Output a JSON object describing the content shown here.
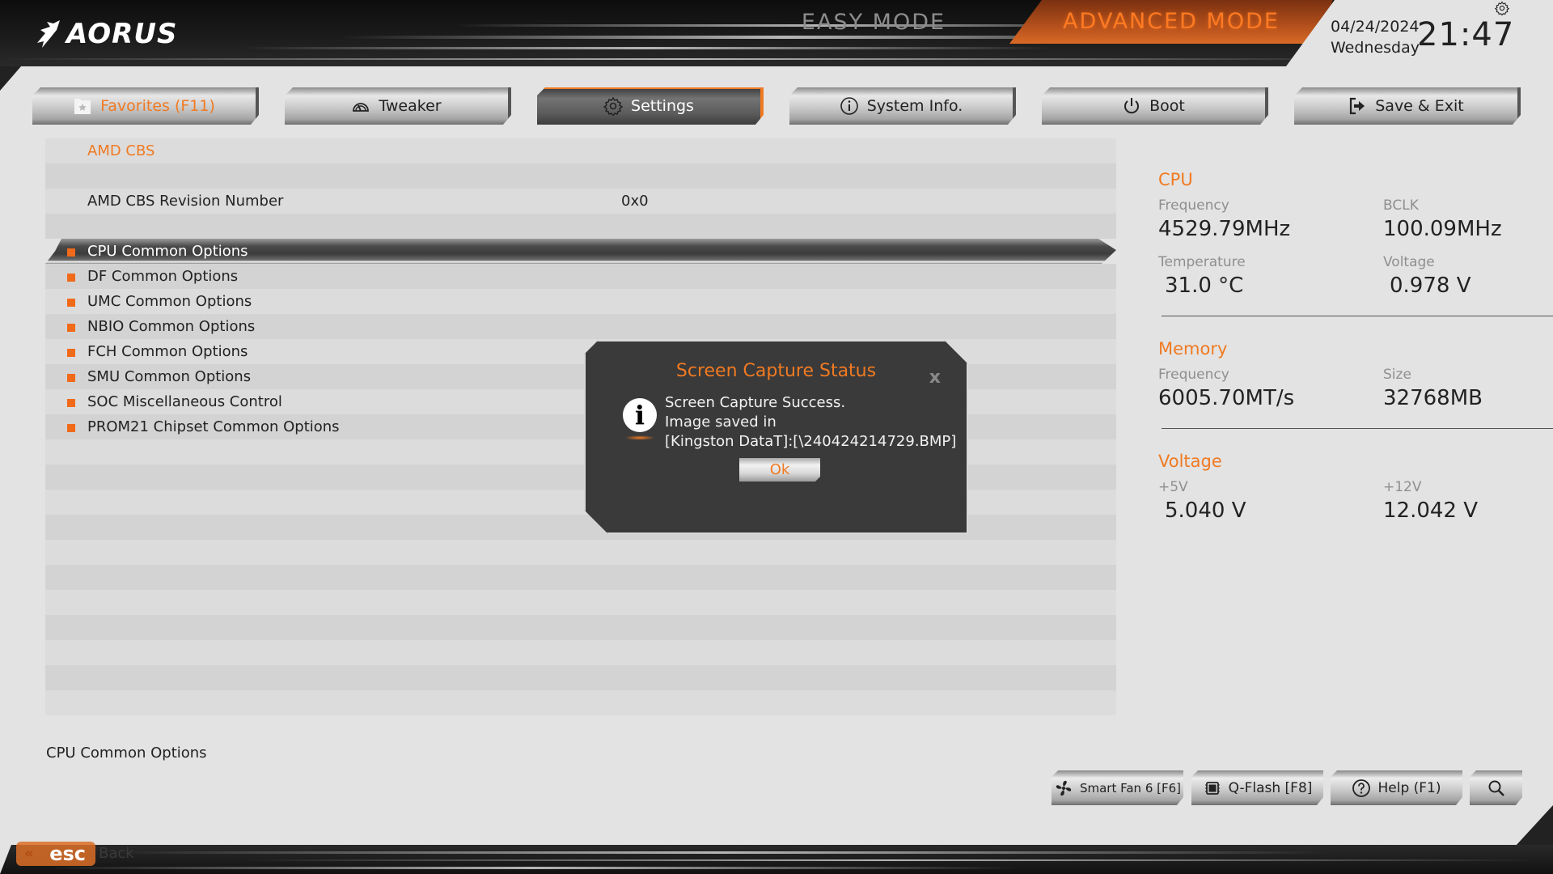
{
  "header": {
    "logo_text": "AORUS",
    "easy_mode_label": "EASY MODE",
    "advanced_mode_label": "ADVANCED MODE",
    "date": "04/24/2024",
    "weekday": "Wednesday",
    "time": "21:47"
  },
  "tabs": [
    {
      "label": "Favorites (F11)",
      "icon": "star-folder-icon"
    },
    {
      "label": "Tweaker",
      "icon": "speedometer-icon"
    },
    {
      "label": "Settings",
      "icon": "gear-icon",
      "active": true
    },
    {
      "label": "System Info.",
      "icon": "info-icon"
    },
    {
      "label": "Boot",
      "icon": "power-icon"
    },
    {
      "label": "Save & Exit",
      "icon": "exit-icon"
    }
  ],
  "main": {
    "section_title": "AMD CBS",
    "revision_label": "AMD CBS Revision Number",
    "revision_value": "0x0",
    "menu_items": [
      "CPU Common Options",
      "DF Common Options",
      "UMC Common Options",
      "NBIO Common Options",
      "FCH Common Options",
      "SMU Common Options",
      "SOC Miscellaneous Control",
      "PROM21 Chipset Common Options"
    ],
    "selected_item": "CPU Common Options",
    "help_text": "CPU Common Options"
  },
  "panel": {
    "cpu": {
      "title": "CPU",
      "frequency_label": "Frequency",
      "frequency": "4529.79MHz",
      "bclk_label": "BCLK",
      "bclk": "100.09MHz",
      "temperature_label": "Temperature",
      "temperature": "31.0 °C",
      "voltage_label": "Voltage",
      "voltage": "0.978 V"
    },
    "memory": {
      "title": "Memory",
      "frequency_label": "Frequency",
      "frequency": "6005.70MT/s",
      "size_label": "Size",
      "size": "32768MB"
    },
    "voltage": {
      "title": "Voltage",
      "v5_label": "+5V",
      "v5": "5.040 V",
      "v12_label": "+12V",
      "v12": "12.042 V"
    }
  },
  "bottom_buttons": {
    "smart_fan": "Smart Fan 6 [F6]",
    "qflash": "Q-Flash [F8]",
    "help": "Help (F1)"
  },
  "footer": {
    "esc_label": "esc",
    "back_label": "Back"
  },
  "dialog": {
    "title": "Screen Capture Status",
    "close": "x",
    "line1": "Screen Capture Success.",
    "line2": "Image saved in",
    "line3": "[Kingston DataT]:[\\240424214729.BMP]",
    "ok_label": "Ok"
  },
  "colors": {
    "accent": "#f07a22",
    "bullet": "#f06a1a",
    "background": "#e3e3e3",
    "dialog_bg": "#3a3a3a"
  }
}
